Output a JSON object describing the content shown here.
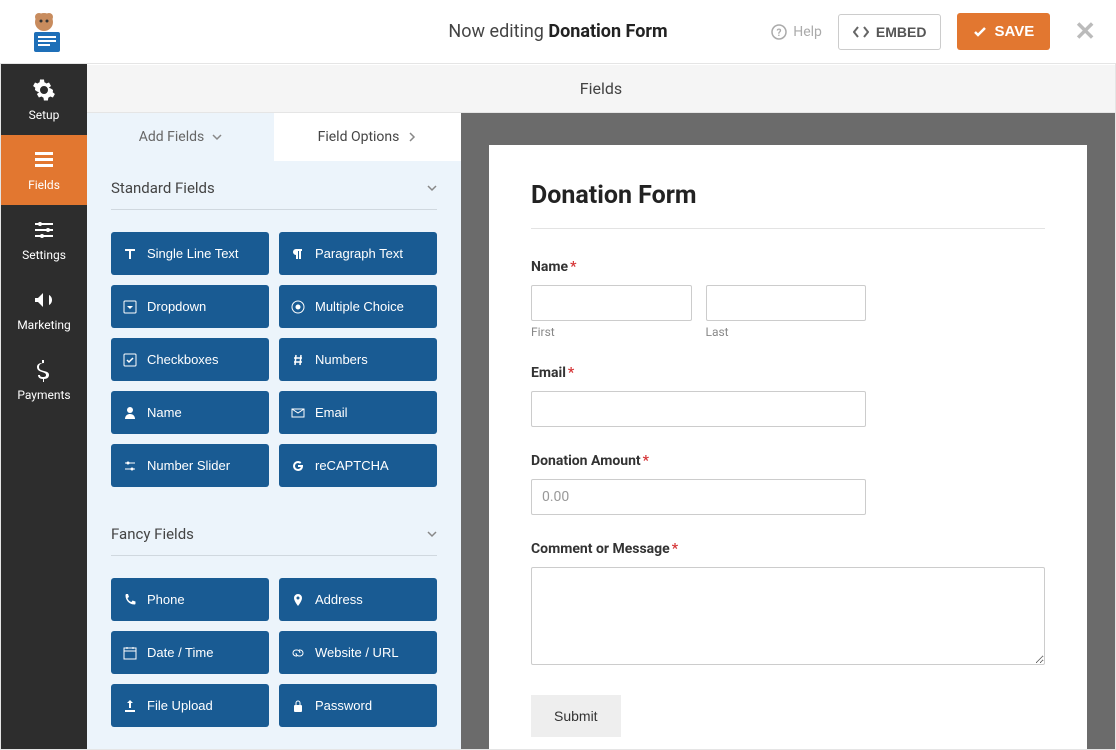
{
  "header": {
    "editing_prefix": "Now editing ",
    "form_name": "Donation Form",
    "help": "Help",
    "embed": "EMBED",
    "save": "SAVE"
  },
  "sidebar": {
    "setup": "Setup",
    "fields": "Fields",
    "settings": "Settings",
    "marketing": "Marketing",
    "payments": "Payments"
  },
  "main_header": "Fields",
  "panel_tabs": {
    "add_fields": "Add Fields",
    "field_options": "Field Options"
  },
  "sections": {
    "standard": "Standard Fields",
    "fancy": "Fancy Fields"
  },
  "standard_fields": {
    "single_line": "Single Line Text",
    "paragraph": "Paragraph Text",
    "dropdown": "Dropdown",
    "multiple_choice": "Multiple Choice",
    "checkboxes": "Checkboxes",
    "numbers": "Numbers",
    "name": "Name",
    "email": "Email",
    "number_slider": "Number Slider",
    "recaptcha": "reCAPTCHA"
  },
  "fancy_fields": {
    "phone": "Phone",
    "address": "Address",
    "date_time": "Date / Time",
    "website": "Website / URL",
    "file_upload": "File Upload",
    "password": "Password"
  },
  "form": {
    "title": "Donation Form",
    "name_label": "Name",
    "first": "First",
    "last": "Last",
    "email_label": "Email",
    "donation_label": "Donation Amount",
    "donation_placeholder": "0.00",
    "comment_label": "Comment or Message",
    "submit": "Submit"
  }
}
